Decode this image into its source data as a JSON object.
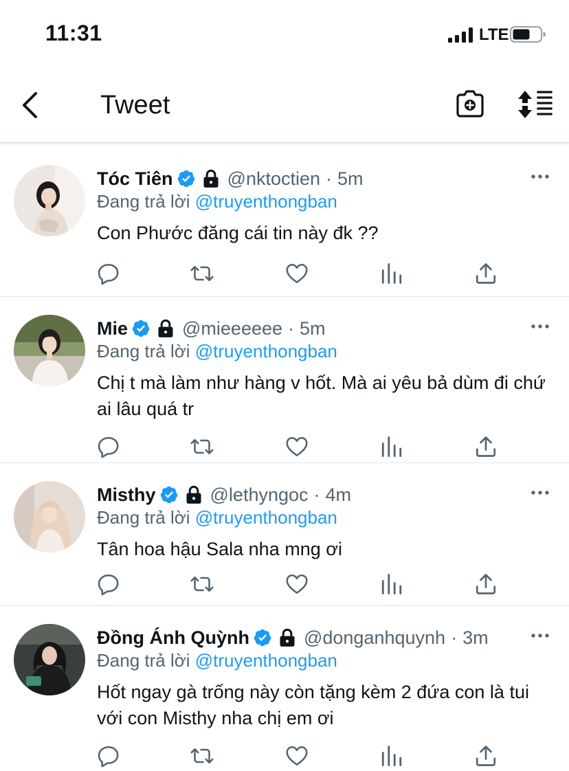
{
  "status_bar": {
    "time": "11:31",
    "network": "LTE"
  },
  "nav": {
    "title": "Tweet"
  },
  "tweets": [
    {
      "name": "Tóc Tiên",
      "handle": "@nktoctien",
      "time": "5m",
      "reply_prefix": "Đang trả lời ",
      "reply_handle": "@truyenthongban",
      "text": "Con Phước đăng cái tin này đk ??"
    },
    {
      "name": "Mie",
      "handle": "@mieeeeee",
      "time": "5m",
      "reply_prefix": "Đang trả lời ",
      "reply_handle": "@truyenthongban",
      "text": "Chị t mà làm như hàng v hốt. Mà ai yêu bả dùm đi chứ ai lâu quá tr"
    },
    {
      "name": "Misthy",
      "handle": "@lethyngoc",
      "time": "4m",
      "reply_prefix": "Đang trả lời ",
      "reply_handle": "@truyenthongban",
      "text": "Tân hoa hậu Sala nha mng ơi"
    },
    {
      "name": "Đồng Ánh Quỳnh",
      "handle": "@donganhquynh",
      "time": "3m",
      "reply_prefix": "Đang trả lời ",
      "reply_handle": "@truyenthongban",
      "text": "Hốt ngay gà trống này còn tặng kèm 2 đứa con là tui với con Misthy nha chị em ơi"
    }
  ],
  "icons": {
    "back": "chevron-left-icon",
    "camera": "camera-plus-icon",
    "sort": "sort-icon",
    "verified": "verified-badge-icon",
    "lock": "lock-icon",
    "more": "more-horizontal-icon",
    "reply": "reply-icon",
    "retweet": "retweet-icon",
    "like": "heart-icon",
    "stats": "analytics-icon",
    "share": "share-icon"
  },
  "colors": {
    "accent": "#1d9bf0",
    "text_primary": "#0f1419",
    "text_secondary": "#536471",
    "divider": "#e1e8ed"
  }
}
